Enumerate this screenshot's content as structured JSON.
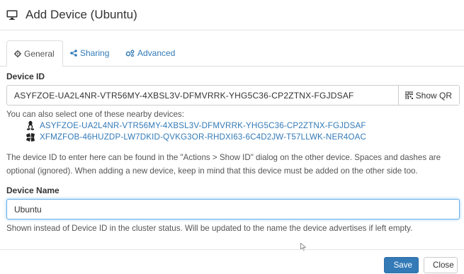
{
  "dialog": {
    "title": "Add Device (Ubuntu)",
    "icon": "monitor-icon"
  },
  "tabs": [
    {
      "label": "General",
      "icon": "gear-icon",
      "active": true
    },
    {
      "label": "Sharing",
      "icon": "share-icon",
      "active": false
    },
    {
      "label": "Advanced",
      "icon": "cogs-icon",
      "active": false
    }
  ],
  "device_id": {
    "label": "Device ID",
    "value": "ASYFZOE-UA2L4NR-VTR56MY-4XBSL3V-DFMVRRK-YHG5C36-CP2ZTNX-FGJDSAF",
    "show_qr_label": "Show QR",
    "nearby_text": "You can also select one of these nearby devices:",
    "nearby_devices": [
      {
        "id": "ASYFZOE-UA2L4NR-VTR56MY-4XBSL3V-DFMVRRK-YHG5C36-CP2ZTNX-FGJDSAF",
        "icon": "linux-icon"
      },
      {
        "id": "XFMZFOB-46HUZDP-LW7DKID-QVKG3OR-RHDXI63-6C4D2JW-T57LLWK-NER4OAC",
        "icon": "windows-icon"
      }
    ],
    "help_line1": "The device ID to enter here can be found in the \"Actions > Show ID\" dialog on the other device. Spaces and dashes are",
    "help_line2": "optional (ignored). When adding a new device, keep in mind that this device must be added on the other side too."
  },
  "device_name": {
    "label": "Device Name",
    "value": "Ubuntu",
    "help": "Shown instead of Device ID in the cluster status. Will be updated to the name the device advertises if left empty."
  },
  "footer": {
    "save_label": "Save",
    "close_label": "Close"
  },
  "colors": {
    "link": "#337ab7",
    "primary": "#337ab7",
    "focus_border": "#66afe9"
  }
}
